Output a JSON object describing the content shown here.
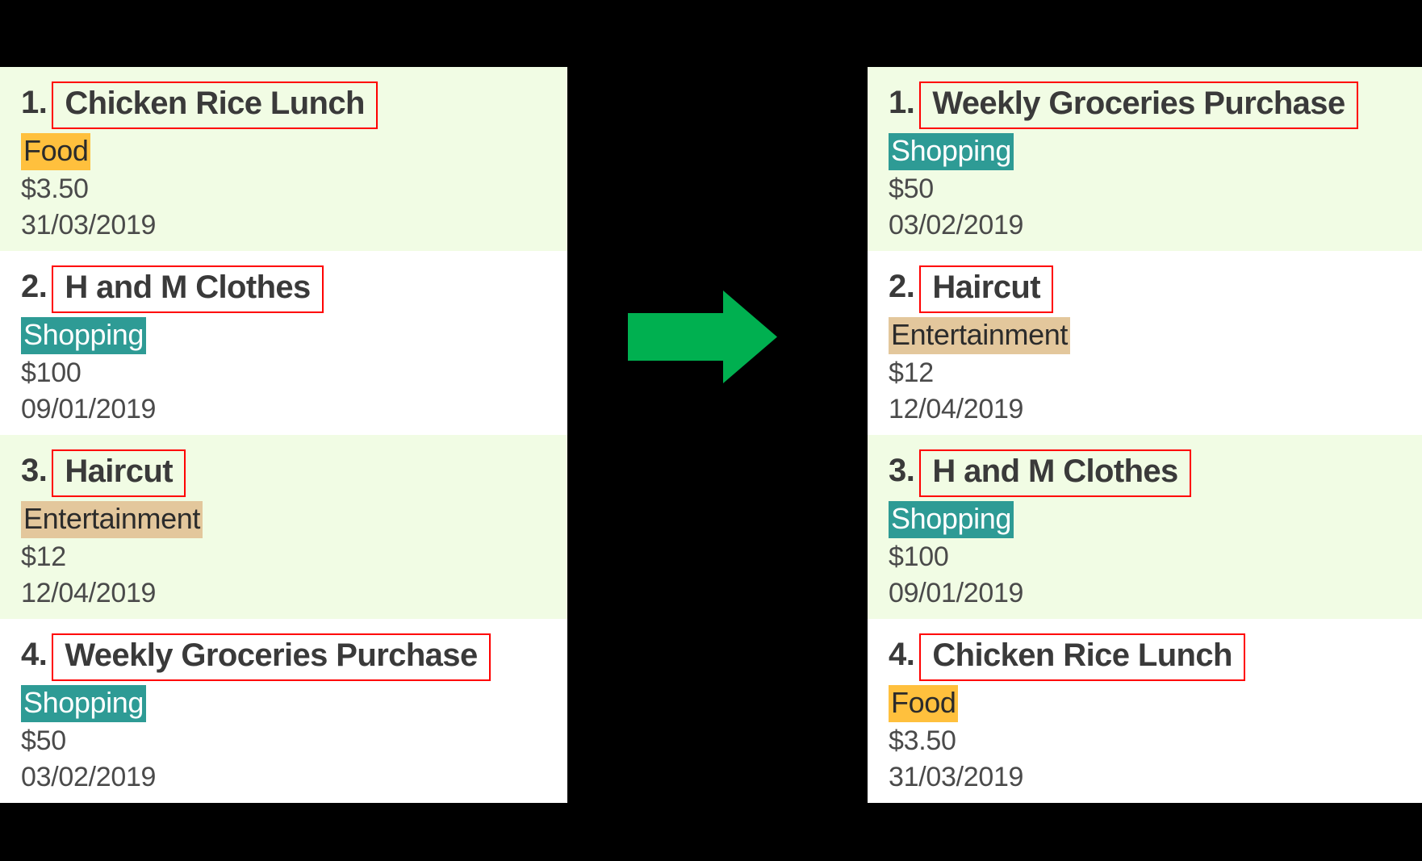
{
  "colors": {
    "stripe_green": "#F1FCE4",
    "stripe_white": "#FFFFFF",
    "backdrop": "#000000",
    "highlight_box": "#FF0000",
    "arrow": "#00B050",
    "tag_shopping": "#2E9B95",
    "tag_food": "#FFC03D",
    "tag_entertainment": "#E3C79C",
    "text": "#3A3A3A"
  },
  "arrow": {
    "icon": "right-arrow-icon",
    "direction": "right"
  },
  "panels": {
    "before": {
      "name": "unsorted-expense-list",
      "items": [
        {
          "index": "1.",
          "title": "Chicken Rice Lunch",
          "category": "Food",
          "category_class": "cat-food",
          "amount": "$3.50",
          "date": "31/03/2019",
          "stripe": "stripe-green"
        },
        {
          "index": "2.",
          "title": "H and M Clothes",
          "category": "Shopping",
          "category_class": "cat-shopping",
          "amount": "$100",
          "date": "09/01/2019",
          "stripe": "stripe-white"
        },
        {
          "index": "3.",
          "title": "Haircut",
          "category": "Entertainment",
          "category_class": "cat-entertainment",
          "amount": "$12",
          "date": "12/04/2019",
          "stripe": "stripe-green"
        },
        {
          "index": "4.",
          "title": "Weekly Groceries Purchase",
          "category": "Shopping",
          "category_class": "cat-shopping",
          "amount": "$50",
          "date": "03/02/2019",
          "stripe": "stripe-white"
        }
      ]
    },
    "after": {
      "name": "sorted-expense-list",
      "items": [
        {
          "index": "1.",
          "title": "Weekly Groceries Purchase",
          "category": "Shopping",
          "category_class": "cat-shopping",
          "amount": "$50",
          "date": "03/02/2019",
          "stripe": "stripe-green"
        },
        {
          "index": "2.",
          "title": "Haircut",
          "category": "Entertainment",
          "category_class": "cat-entertainment",
          "amount": "$12",
          "date": "12/04/2019",
          "stripe": "stripe-white"
        },
        {
          "index": "3.",
          "title": "H and M Clothes",
          "category": "Shopping",
          "category_class": "cat-shopping",
          "amount": "$100",
          "date": "09/01/2019",
          "stripe": "stripe-green"
        },
        {
          "index": "4.",
          "title": "Chicken Rice Lunch",
          "category": "Food",
          "category_class": "cat-food",
          "amount": "$3.50",
          "date": "31/03/2019",
          "stripe": "stripe-white"
        }
      ]
    }
  }
}
